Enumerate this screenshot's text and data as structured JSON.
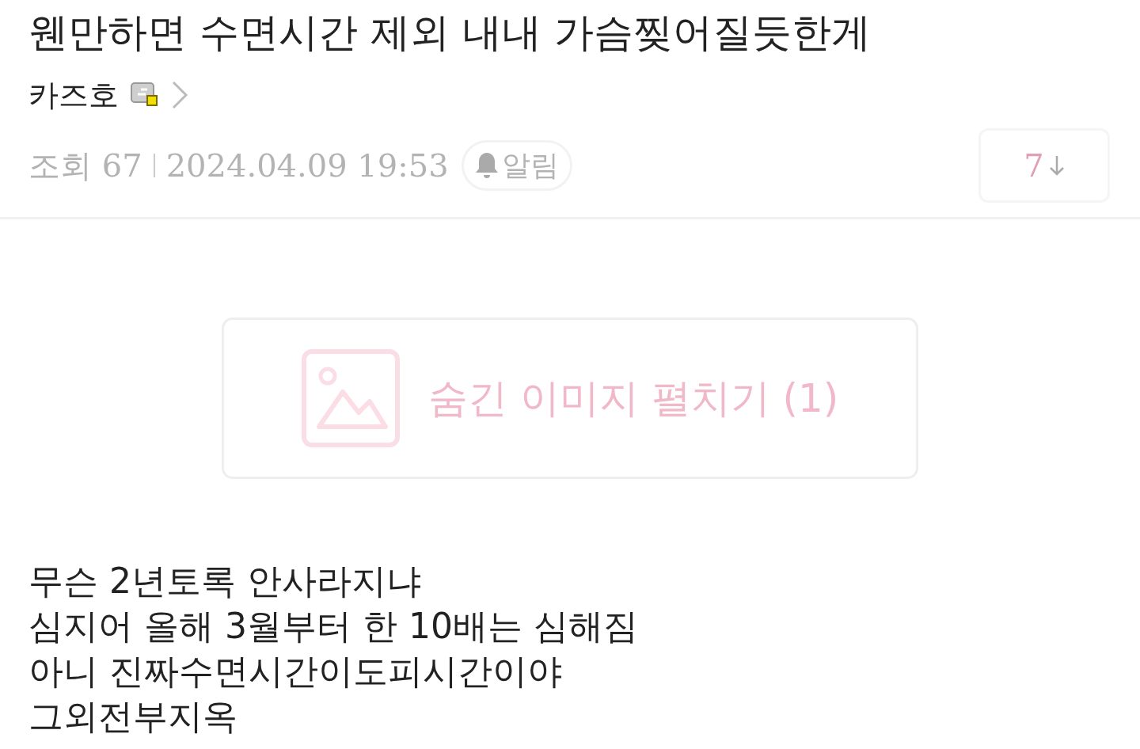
{
  "post": {
    "title": "웬만하면 수면시간 제외 내내 가슴찢어질듯한게",
    "author": "카즈호",
    "views": "조회 67",
    "date": "2024.04.09 19:53",
    "alert_button": "알림",
    "comment_count": "7"
  },
  "hidden_image": {
    "label": "숨긴 이미지 펼치기 (1)"
  },
  "body": {
    "lines": [
      "무슨 2년토록 안사라지냐",
      "심지어 올해 3월부터 한 10배는 심해짐",
      "아니 진짜수면시간이도피시간이야",
      "그외전부지옥"
    ]
  }
}
